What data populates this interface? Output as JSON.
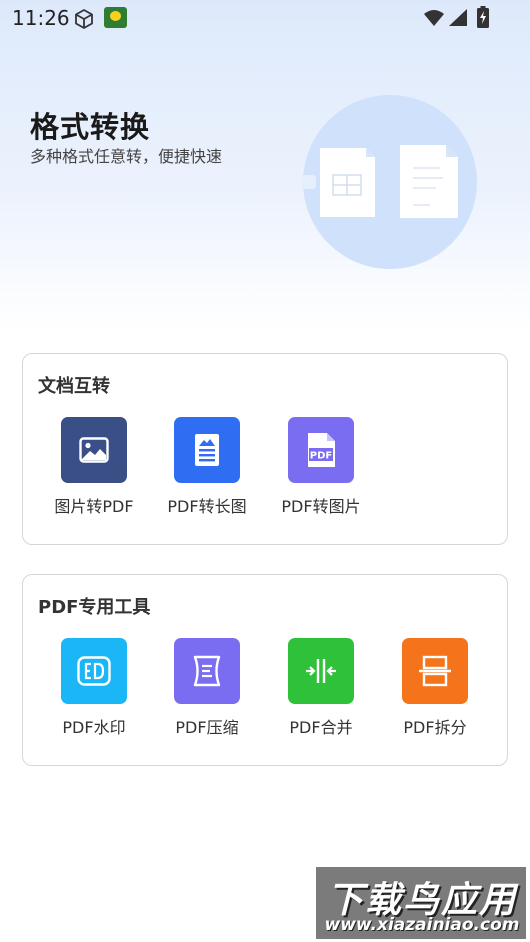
{
  "status_bar": {
    "time": "11:26",
    "icons": [
      "box-icon",
      "app-notification-icon",
      "wifi-icon",
      "signal-icon",
      "battery-charging-icon"
    ]
  },
  "hero": {
    "title": "格式转换",
    "subtitle": "多种格式任意转，便捷快速"
  },
  "sections": [
    {
      "title": "文档互转",
      "tools": [
        {
          "label": "图片转PDF",
          "icon": "image-icon",
          "color": "#3a4f86"
        },
        {
          "label": "PDF转长图",
          "icon": "long-image-icon",
          "color": "#2f6df2"
        },
        {
          "label": "PDF转图片",
          "icon": "pdf-file-icon",
          "color": "#7a6df2"
        }
      ]
    },
    {
      "title": "PDF专用工具",
      "tools": [
        {
          "label": "PDF水印",
          "icon": "watermark-icon",
          "color": "#1ab6f5"
        },
        {
          "label": "PDF压缩",
          "icon": "compress-icon",
          "color": "#7a6df2"
        },
        {
          "label": "PDF合并",
          "icon": "merge-icon",
          "color": "#2fc13a"
        },
        {
          "label": "PDF拆分",
          "icon": "split-icon",
          "color": "#f5731a"
        }
      ]
    }
  ],
  "watermark": {
    "brand": "下载鸟应用",
    "url": "www.xiazainiao.com"
  }
}
